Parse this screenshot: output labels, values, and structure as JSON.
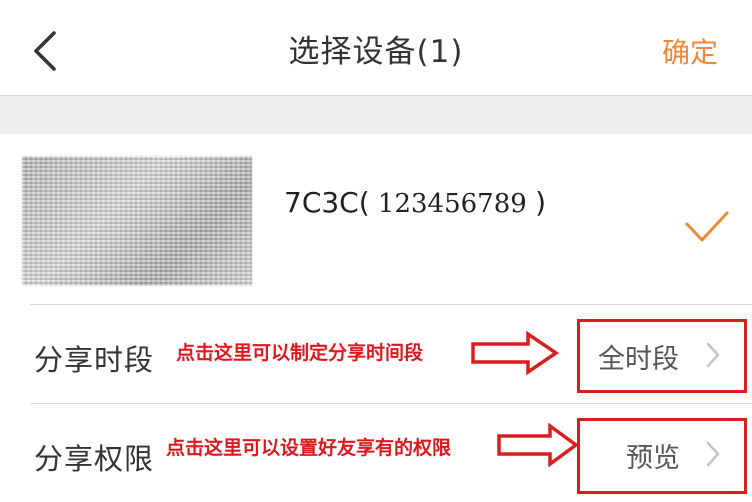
{
  "header": {
    "title": "选择设备(1)",
    "confirm_label": "确定",
    "back_icon": "chevron-left-icon"
  },
  "device": {
    "name": "7C3C(",
    "serial": " 123456789  ",
    "close": ")",
    "selected": true,
    "check_color": "#f0873a"
  },
  "settings": [
    {
      "label": "分享时段",
      "annotation": "点击这里可以制定分享时间段",
      "value": "全时段"
    },
    {
      "label": "分享权限",
      "annotation": "点击这里可以设置好友享有的权限",
      "value": "预览"
    }
  ],
  "colors": {
    "accent": "#f0873a",
    "annotation": "#e0181e",
    "separator_band": "#ececec"
  }
}
